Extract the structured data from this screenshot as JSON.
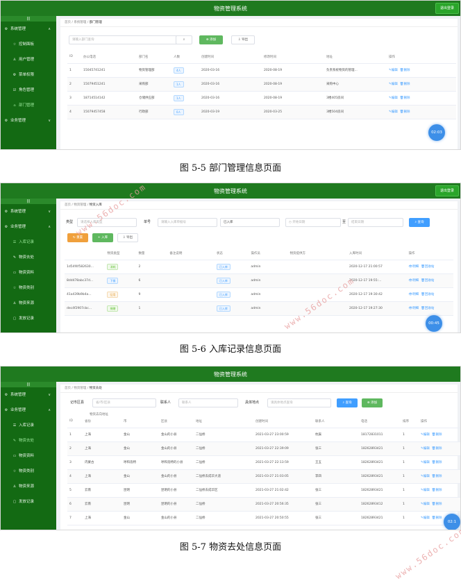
{
  "app_title": "物资管理系统",
  "logout_label": "退出登录",
  "collapse_label": "|||",
  "s1": {
    "breadcrumb": [
      "首页",
      "系统管理",
      "部门管理"
    ],
    "menu": {
      "group1": "系统管理",
      "items": [
        "控制面板",
        "用户管理",
        "菜单权限",
        "角色管理",
        "部门管理"
      ],
      "group2": "业务管理"
    },
    "search_placeholder": "请输入部门查询",
    "add_label": "添加",
    "export_label": "导出",
    "headers": [
      "ID",
      "办公电话",
      "部门名",
      "人数",
      "创建时间",
      "修改时间",
      "地址",
      "操作"
    ],
    "rows": [
      [
        "1",
        "15045741241",
        "物资管理部",
        "4人",
        "2020-03-16",
        "2020-08-19",
        "负责系统物资的管理..."
      ],
      [
        "2",
        "15079451241",
        "采购部",
        "1人",
        "2020-03-16",
        "2020-08-19",
        "采购中心"
      ],
      [
        "3",
        "18714514142",
        "仓储供应部",
        "1人",
        "2020-03-16",
        "2020-08-19",
        "3楼405房间"
      ],
      [
        "4",
        "15079457458",
        "行政部",
        "0人",
        "2020-03-19",
        "2020-03-25",
        "3楼504房间"
      ]
    ],
    "edit_label": "编辑",
    "delete_label": "删除",
    "clock": "02:03",
    "caption": "图 5-5 部门管理信息页面"
  },
  "s2": {
    "breadcrumb": [
      "首页",
      "物资管理",
      "物资入库"
    ],
    "menu": {
      "group1": "系统管理",
      "group2": "业务管理",
      "items": [
        "入库记录",
        "物资去处",
        "物资资料",
        "物资类别",
        "物资来源",
        "发放记录"
      ]
    },
    "type_label": "类型",
    "type_placeholder": "请选择入库类型",
    "no_label": "单号",
    "no_placeholder": "请输入入库单据号",
    "status_value": "已入库",
    "date_start": "开始日期",
    "date_sep": "至",
    "date_end": "结束日期",
    "search_label": "查询",
    "reset_label": "重置",
    "in_label": "入库",
    "export_label": "导出",
    "headers": [
      "",
      "物资类型",
      "数量",
      "备注说明",
      "状态",
      "操作员",
      "物资提供方",
      "入库时间",
      "操作"
    ],
    "rows": [
      [
        "1d54f4f582630...",
        "消耗",
        "2",
        "已入库",
        "admin",
        "2020-12-17 21:00:57"
      ],
      [
        "8dd478abc37d...",
        "下拨",
        "6",
        "已入库",
        "admin",
        "2020-12-17 19:55:..."
      ],
      [
        "41a439b9b4a...",
        "征用",
        "9",
        "已入库",
        "admin",
        "2020-12-17 19:30:42"
      ],
      [
        "dec4f2907cbc...",
        "捐赠",
        "1",
        "已入库",
        "admin",
        "2020-12-17 19:27:30"
      ]
    ],
    "detail_label": "明细",
    "invalid_label": "回收站",
    "clock": "00:45",
    "caption": "图 5-6 入库记录信息页面"
  },
  "s3": {
    "breadcrumb": [
      "首页",
      "物资管理",
      "物资去处"
    ],
    "menu": {
      "group1": "系统管理",
      "group2": "业务管理",
      "items": [
        "入库记录",
        "物资去处",
        "物资资料",
        "物资类别",
        "物资来源",
        "发放记录"
      ]
    },
    "area_label": "记市区县",
    "area_placeholder": "省/市/区县",
    "contact_label": "联系人",
    "contact_placeholder": "联系人",
    "addr_label": "具体地点",
    "addr_placeholder": "请具体地点查询",
    "search_label": "查询",
    "add_label": "添加",
    "group_header": "物资去向地址",
    "headers": [
      "ID",
      "省份",
      "市",
      "区县",
      "地址",
      "创建时间",
      "联系人",
      "电话",
      "排序",
      "操作"
    ],
    "rows": [
      [
        "1",
        "上海",
        "金山",
        "金山的小县",
        "二仙桥",
        "2021-03-27 23:00:59",
        "杭辰",
        "18172831011",
        "1"
      ],
      [
        "2",
        "上海",
        "金山",
        "金山的小县",
        "二仙桥",
        "2021-03-27 22:39:09",
        "张三",
        "18262893421",
        "1"
      ],
      [
        "3",
        "内蒙古",
        "呼和浩特",
        "呼和浩特的小县",
        "二仙桥",
        "2021-03-27 22:13:59",
        "王五",
        "18262893421",
        "1"
      ],
      [
        "4",
        "上海",
        "金山",
        "金山的小县",
        "二仙桥去成华大道",
        "2021-03-27 21:03:05",
        "李四",
        "18262893421",
        "1"
      ],
      [
        "5",
        "云南",
        "昆明",
        "昆明的小县",
        "二仙桥去成华区",
        "2021-03-27 21:02:42",
        "张三",
        "18262893421",
        "1"
      ],
      [
        "6",
        "云南",
        "昆明",
        "昆明的小县",
        "二仙桥",
        "2021-03-27 20:56:35",
        "张三",
        "18262893412",
        "1"
      ],
      [
        "7",
        "上海",
        "金山",
        "金山的小县",
        "二仙桥",
        "2021-03-27 20:50:55",
        "张三",
        "18262893421",
        "1"
      ]
    ],
    "edit_label": "编辑",
    "delete_label": "删除",
    "clock": "02:1",
    "caption": "图 5-7 物资去处信息页面"
  },
  "watermark": "www.56doc.com"
}
